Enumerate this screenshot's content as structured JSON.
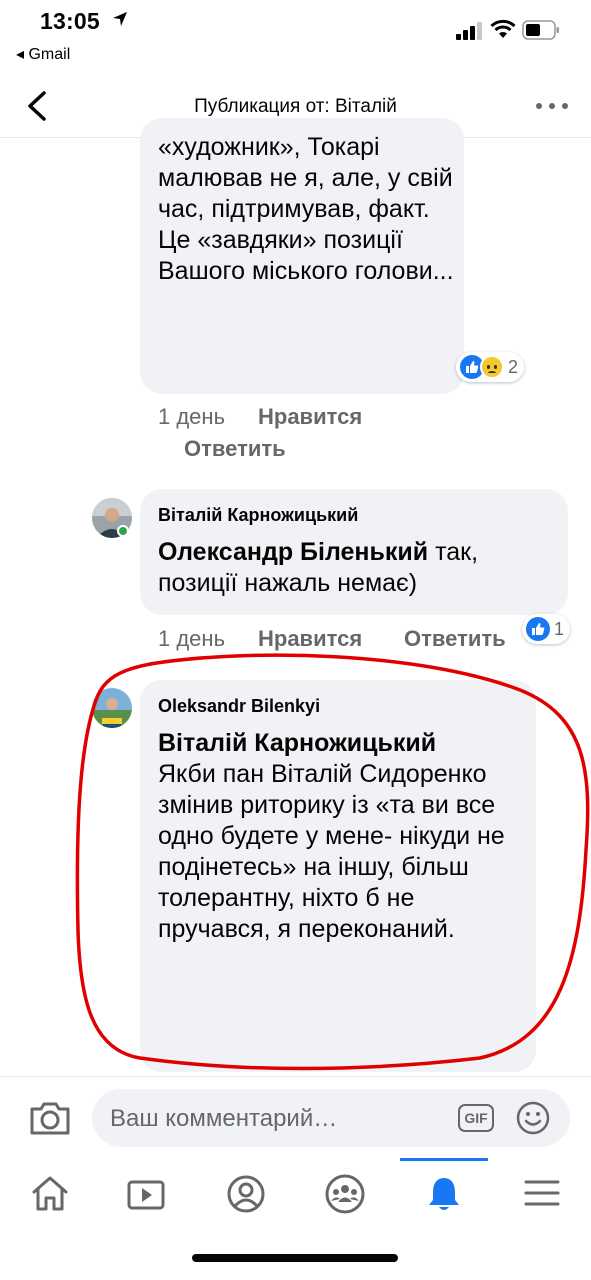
{
  "status_bar": {
    "time": "13:05",
    "back_app": "◂ Gmail"
  },
  "header": {
    "title": "Публикация от: Віталій"
  },
  "comments": [
    {
      "text": "«художник», Токарі малював не я, але, у свій час, підтримував, факт. Це «завдяки» позиції Вашого міського голови...",
      "time": "1 день",
      "like_label": "Нравится",
      "reply_label": "Ответить",
      "reactions_count": "2"
    },
    {
      "author": "Віталій Карножицький",
      "mention": "Олександр Біленький",
      "text": " так, позиції нажаль немає)",
      "time": "1 день",
      "like_label": "Нравится",
      "reply_label": "Ответить",
      "reactions_count": "1"
    },
    {
      "author": "Oleksandr Bilenkyi",
      "mention": "Віталій Карножицький",
      "text": "Якби пан Віталій Сидоренко змінив риторику із «та ви все одно будете у мене- нікуди не подінетесь» на іншу, більш толерантну, ніхто б не пручався, я переконаний."
    }
  ],
  "composer": {
    "placeholder": "Ваш комментарий…",
    "gif_label": "GIF"
  },
  "tabs": [
    {
      "icon": "home-icon"
    },
    {
      "icon": "video-icon"
    },
    {
      "icon": "profile-icon"
    },
    {
      "icon": "groups-icon"
    },
    {
      "icon": "notifications-icon",
      "active": true
    },
    {
      "icon": "menu-icon"
    }
  ],
  "colors": {
    "accent": "#1877f2",
    "bubble": "#f0f2f5",
    "annotation": "#e00000"
  }
}
